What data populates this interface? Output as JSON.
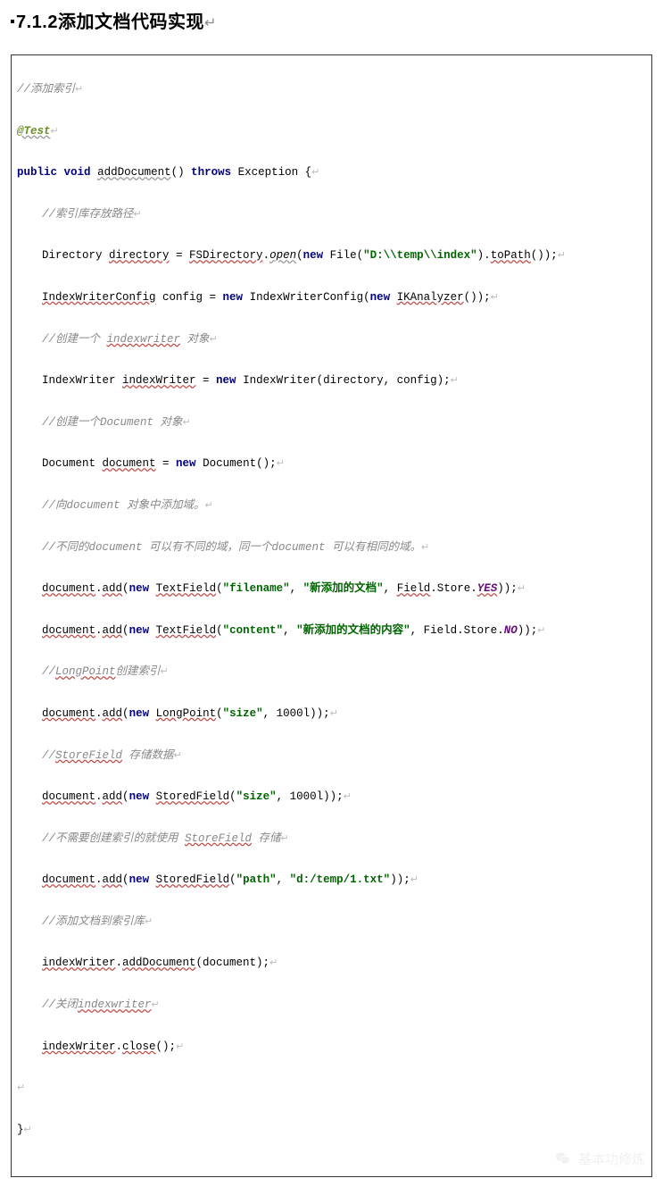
{
  "heading": {
    "section_number": "7.1.2",
    "title": "添加文档代码实现",
    "eol_marker": "↵"
  },
  "code": {
    "c_add_index": "//添加索引",
    "annotation": "@Test",
    "sig_kw1": "public",
    "sig_kw2": "void",
    "sig_name": "addDocument",
    "sig_paren": "()",
    "sig_throws": "throws",
    "sig_exc": "Exception {",
    "c_path": "//索引库存放路径",
    "l_dir_a": "Directory ",
    "l_dir_var": "directory",
    "l_dir_b": " = ",
    "l_dir_fs": "FSDirectory",
    "l_dir_dot": ".",
    "l_dir_open": "open",
    "l_dir_c": "(",
    "kw_new": "new",
    "l_dir_file": " File(",
    "str_path": "\"D:\\\\temp\\\\index\"",
    "l_dir_d": ").",
    "l_dir_topath": "toPath",
    "l_dir_e": "());",
    "l_cfg_a": "IndexWriterConfig",
    "l_cfg_b": " config = ",
    "l_cfg_c": " IndexWriterConfig(",
    "l_cfg_ik": "IKAnalyzer",
    "l_cfg_d": "());",
    "c_iw": "//创建一个 ",
    "c_iw_u": "indexwriter",
    "c_iw_end": " 对象",
    "l_iw_a": "IndexWriter ",
    "l_iw_var": "indexWriter",
    "l_iw_b": " = ",
    "l_iw_c": " IndexWriter(directory, config);",
    "c_doc": "//创建一个Document 对象",
    "l_doc_a": "Document ",
    "l_doc_var": "document",
    "l_doc_b": " = ",
    "l_doc_c": " Document();",
    "c_addfield": "//向document 对象中添加域。",
    "c_diff": "//不同的document 可以有不同的域，同一个document 可以有相同的域。",
    "l_f1_a": "document",
    "l_f1_dot": ".",
    "l_f1_add": "add",
    "l_f1_b": "(",
    "l_f1_tf": "TextField",
    "l_f1_c": "(",
    "str_filename": "\"filename\"",
    "l_comma": ", ",
    "str_newdoc": "\"新添加的文档\"",
    "l_f1_d": ", ",
    "l_f1_fs": "Field",
    "l_f1_store": ".Store.",
    "enum_yes": "YES",
    "l_f1_e": "));",
    "str_content": "\"content\"",
    "str_newcontent": "\"新添加的文档的内容\"",
    "l_f2_d": ", Field.Store.",
    "enum_no": "NO",
    "c_lp": "//",
    "c_lp_u": "LongPoint",
    "c_lp_end": "创建索引",
    "l_lp_tf": "LongPoint",
    "str_size": "\"size\"",
    "lit_1000": "1000l",
    "c_sf": "//",
    "c_sf_u": "StoreField",
    "c_sf_end": " 存储数据",
    "l_sf_tf": "StoredField",
    "c_nosf": "//不需要创建索引的就使用 ",
    "c_nosf_u": "StoreField",
    "c_nosf_end": " 存储",
    "str_pathkey": "\"path\"",
    "str_pathval": "\"d:/temp/1.txt\"",
    "c_addlib": "//添加文档到索引库",
    "l_add_a": "indexWriter",
    "l_add_b": ".",
    "l_add_m": "addDocument",
    "l_add_c": "(document);",
    "c_close": "//关闭",
    "c_close_u": "indexwriter",
    "l_close_a": "indexWriter",
    "l_close_b": ".",
    "l_close_m": "close",
    "l_close_c": "();",
    "brace": "}",
    "eol": "↵",
    "eolcr": "↵"
  },
  "watermark": {
    "text": "基本功修炼"
  }
}
